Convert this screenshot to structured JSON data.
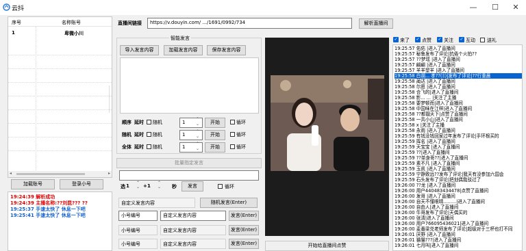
{
  "window": {
    "title": "云抖",
    "minimize": "—",
    "maximize": "☐",
    "close": "✕"
  },
  "accounts": {
    "headers": [
      "序号",
      "名称账号"
    ],
    "rows": [
      {
        "no": "1",
        "name": "卑微小川"
      }
    ],
    "add_label": "加载账号",
    "login_label": "登录小号"
  },
  "log": [
    {
      "time": "19:24:39",
      "text": "解析成功",
      "color": "#e00000"
    },
    {
      "time": "19:24:39",
      "text": "主播名称:??刘昆???  ??",
      "color": "#e00000"
    },
    {
      "time": "19:25:37",
      "text": "手速太快了 休息一下吧",
      "color": "#1060d0"
    },
    {
      "time": "19:25:41",
      "text": "手速太快了 休息一下吧",
      "color": "#1060d0"
    }
  ],
  "room": {
    "label": "直播间链接",
    "url": "https://v.douyin.com/                 .../1691/0992/734",
    "parse_label": "解析直播间"
  },
  "smart": {
    "title": "智能发言",
    "import_label": "导入发言内容",
    "load_label": "加载发言内容",
    "save_label": "保存发言内容",
    "modes": [
      {
        "label": "顺序",
        "delay": "延时",
        "random": "随机",
        "value": "1",
        "start": "开始",
        "loop": "循环"
      },
      {
        "label": "随机",
        "delay": "延时",
        "random": "随机",
        "value": "1",
        "start": "开始",
        "loop": "循环"
      },
      {
        "label": "全体",
        "delay": "延时",
        "random": "随机",
        "value": "1",
        "start": "开始",
        "loop": "循环"
      }
    ],
    "batch_label": "批量指定发言"
  },
  "bottom": {
    "select_label": "选",
    "select_value": "1",
    "plus_label": "+",
    "plus_value": "1",
    "sec_label": "秒",
    "send_label": "发言",
    "loop_label": "循环",
    "custom_placeholder": "自定义发言内容",
    "random_send_label": "随机发言(Enter)",
    "rows": [
      {
        "id": "小号编号",
        "content": "自定义发言内容",
        "send": "发言(Enter)"
      },
      {
        "id": "小号编号",
        "content": "自定义发言内容",
        "send": "发言(Enter)"
      },
      {
        "id": "小号编号",
        "content": "自定义发言内容",
        "send": "发言(Enter)"
      }
    ]
  },
  "video": {
    "start_like_label": "开始给直播间点赞"
  },
  "filters": [
    {
      "label": "来了",
      "checked": true
    },
    {
      "label": "点赞",
      "checked": true
    },
    {
      "label": "关注",
      "checked": true
    },
    {
      "label": "互动",
      "checked": true
    },
    {
      "label": "送礼",
      "checked": false
    }
  ],
  "chat": [
    {
      "t": "19:25:57",
      "msg": "佑佑 |进入了直播间"
    },
    {
      "t": "19:25:57",
      "msg": "秘鲁发布了评论|抗倦个火拍??"
    },
    {
      "t": "19:25:57",
      "msg": "??梦瑶 |进入了直播间"
    },
    {
      "t": "19:25:57",
      "msg": "翩翩 |进入了直播间"
    },
    {
      "t": "19:25:57",
      "msg": "羊羊望羊 |进入了直播间"
    },
    {
      "t": "19:25:58",
      "msg": "白胡... 孝??(Ξ)|发布了评论|??行重晨"
    },
    {
      "t": "19:25:58",
      "msg": "蔺达 |进入了直播间"
    },
    {
      "t": "19:25:58",
      "msg": "尔愿 |进入了直播间"
    },
    {
      "t": "19:25:58",
      "msg": "合飞的|进入了直播间"
    },
    {
      "t": "19:25:58",
      "msg": "影...  ... |关注了主播"
    },
    {
      "t": "19:25:58",
      "msg": "要梦顿而|进入了直播间"
    },
    {
      "t": "19:25:58",
      "msg": "中国味在江样|进入了直播间"
    },
    {
      "t": "19:25:58",
      "msg": "??都靓天下|点赞了直播间"
    },
    {
      "t": "19:25:58",
      "msg": "一共小山|进入了直播间"
    },
    {
      "t": "19:25:58",
      "msg": "x |关注了主播"
    },
    {
      "t": "19:25:58",
      "msg": "永雨 |进入了直播间"
    },
    {
      "t": "19:25:59",
      "msg": "有钱没钱回家过年发布了评论|手环根买的"
    },
    {
      "t": "19:25:59",
      "msg": "挥名 |进入了直播间"
    },
    {
      "t": "19:25:59",
      "msg": "天宝宝 |进入了直播间"
    },
    {
      "t": "19:25:59",
      "msg": "??|进入了直播间"
    },
    {
      "t": "19:25:59",
      "msg": "??单身哥??|进入了直播间"
    },
    {
      "t": "19:25:59",
      "msg": "素不凡 |进入了直播间"
    },
    {
      "t": "19:25:59",
      "msg": "玉凯 |进入了直播间"
    },
    {
      "t": "19:25:59",
      "msg": "宁静致远??发布了评论|我天有没参加六国会"
    },
    {
      "t": "19:25:59",
      "msg": "石头发布了评论|把划偶我驳过了"
    },
    {
      "t": "19:26:00",
      "msg": "??龙 |进入了直播间"
    },
    {
      "t": "19:26:00",
      "msg": "用户440483434478|点赞了直播间"
    },
    {
      "t": "19:26:00",
      "msg": "发哥 |进入了直播间"
    },
    {
      "t": "19:26:00",
      "msg": "自天不懂眼晴.........|进入了直播间"
    },
    {
      "t": "19:26:00",
      "msg": "自由人|进入了直播间"
    },
    {
      "t": "19:26:00",
      "msg": "牛哥发布了评论|天偶买的"
    },
    {
      "t": "19:26:00",
      "msg": "张清|进入了直播间"
    },
    {
      "t": "19:26:00",
      "msg": "用户766095436021|进入了直播间"
    },
    {
      "t": "19:26:00",
      "msg": "麦番梁兑老师发布了评论|超级对于三杯也打不同"
    },
    {
      "t": "19:26:01",
      "msg": "厌野 |进入了直播间"
    },
    {
      "t": "19:26:01",
      "msg": "猫猫???|进入了直播间"
    },
    {
      "t": "19:26:01",
      "msg": "七月叫|进入了直播间"
    }
  ],
  "chat_selected_index": 5,
  "colors": {
    "accent": "#0a64d0",
    "log_red": "#e00000",
    "log_blue": "#1060d0"
  }
}
